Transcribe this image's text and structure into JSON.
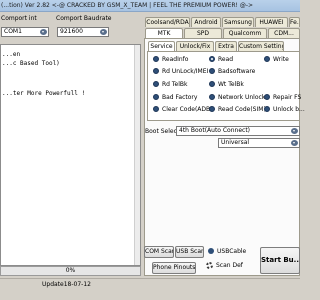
{
  "window": {
    "title": "(...tion) Ver 2.82 <-@ CRACKED BY GSM_X_TEAM | FEEL THE PREMIUM POWER! @->"
  },
  "top": {
    "comport_label": "Comport int",
    "comport_value": "COM1",
    "baud_label": "Comport Baudrate",
    "baud_value": "921600"
  },
  "log": {
    "lines": [
      "...en",
      "...c Based Tool)",
      "...ter More Powerfull !"
    ]
  },
  "progress": {
    "text": "0%",
    "percent": 0
  },
  "status": {
    "update": "Update18-07-12"
  },
  "tabs_row1": [
    "Coolsand/RDA",
    "Android",
    "Samsung",
    "HUAWEI",
    "Fe..."
  ],
  "tabs_row2": [
    "MTK",
    "SPD",
    "Qualcomm",
    "CDM..."
  ],
  "subtabs": [
    "Service",
    "Unlock/Fix",
    "Extra",
    "Custom Setting"
  ],
  "radios": [
    {
      "label": "ReadInfo",
      "selected": false
    },
    {
      "label": "Read",
      "selected": true
    },
    {
      "label": "Write",
      "selected": false
    },
    {
      "label": "Rd UnLock/IMEI",
      "selected": false
    },
    {
      "label": "Badsoftware",
      "selected": false
    },
    {
      "label": "Rd TelBk",
      "selected": false
    },
    {
      "label": "Wt TelBk",
      "selected": false
    },
    {
      "label": "Bad Factory",
      "selected": false
    },
    {
      "label": "Network Unlock",
      "selected": false
    },
    {
      "label": "Repair FS",
      "selected": false
    },
    {
      "label": "Clear Code(ADB)",
      "selected": false
    },
    {
      "label": "Read Code(SIM)",
      "selected": false
    },
    {
      "label": "Unlock b...",
      "selected": false
    }
  ],
  "boot": {
    "label": "Boot Select",
    "value": "4th Boot(Auto Connect)",
    "second_value": "Universal"
  },
  "bottom": {
    "com_scan": "COM Scan",
    "usb_scan": "USB Scan",
    "usb_cable": "USBCable",
    "scan_def": "Scan Def",
    "phone_pinouts": "Phone Pinouts",
    "start": "Start Bu..."
  },
  "colors": {
    "title_bar": "#b9d1ea",
    "radio": "#2f4f78",
    "window_bg": "#d4d0c8"
  }
}
